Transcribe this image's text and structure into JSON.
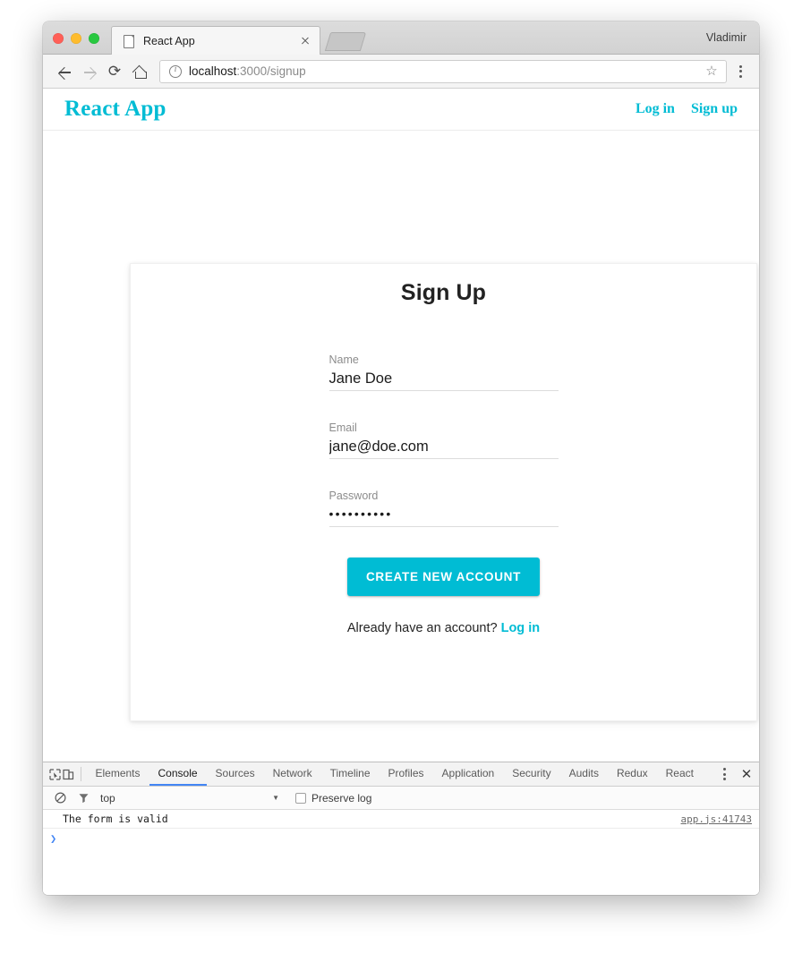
{
  "browser": {
    "tab": {
      "title": "React App",
      "favicon": "page-icon",
      "close": "×"
    },
    "profile_name": "Vladimir",
    "nav": {
      "back": "◀",
      "forward": "▶",
      "reload": "⟳",
      "home": "⌂"
    },
    "address": {
      "scheme_host": "localhost",
      "path": ":3000/signup",
      "info_icon": "info-icon",
      "star": "☆"
    },
    "menu_icon": "kebab-menu-icon"
  },
  "site": {
    "brand": "React App",
    "links": [
      {
        "label": "Log in"
      },
      {
        "label": "Sign up"
      }
    ]
  },
  "form": {
    "title": "Sign Up",
    "fields": [
      {
        "label": "Name",
        "value": "Jane Doe",
        "masked": false
      },
      {
        "label": "Email",
        "value": "jane@doe.com",
        "masked": false
      },
      {
        "label": "Password",
        "value": "••••••••••",
        "masked": true
      }
    ],
    "submit_label": "CREATE NEW ACCOUNT",
    "footer_text": "Already have an account?",
    "footer_link": "Log in"
  },
  "devtools": {
    "inspect_icon": "inspect-element-icon",
    "device_icon": "device-toolbar-icon",
    "tabs": [
      {
        "label": "Elements",
        "active": false
      },
      {
        "label": "Console",
        "active": true
      },
      {
        "label": "Sources",
        "active": false
      },
      {
        "label": "Network",
        "active": false
      },
      {
        "label": "Timeline",
        "active": false
      },
      {
        "label": "Profiles",
        "active": false
      },
      {
        "label": "Application",
        "active": false
      },
      {
        "label": "Security",
        "active": false
      },
      {
        "label": "Audits",
        "active": false
      },
      {
        "label": "Redux",
        "active": false
      },
      {
        "label": "React",
        "active": false
      }
    ],
    "more_icon": "kebab-menu-icon",
    "close_icon": "✕",
    "filterbar": {
      "clear_icon": "clear-console-icon",
      "filter_icon": "filter-funnel-icon",
      "context": "top",
      "caret": "▼",
      "preserve_log": "Preserve log",
      "preserve_checked": false
    },
    "console": {
      "message": "The form is valid",
      "source": "app.js:41743",
      "prompt": "❯"
    }
  },
  "colors": {
    "accent": "#00bcd4",
    "devtools_active": "#4285f4"
  }
}
